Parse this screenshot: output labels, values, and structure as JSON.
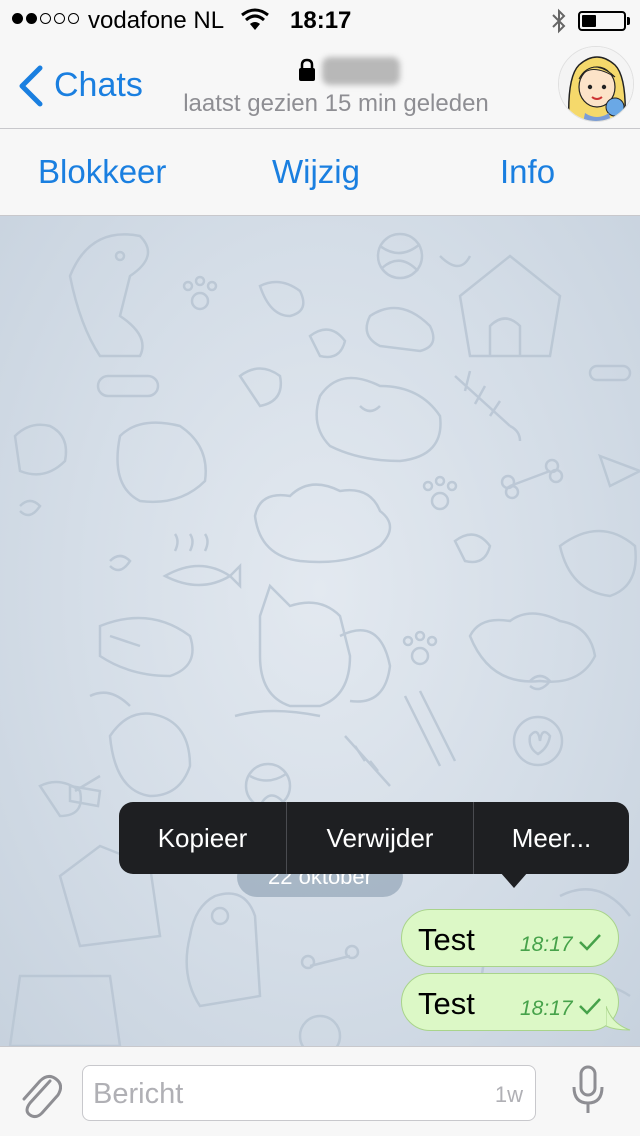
{
  "status_bar": {
    "carrier": "vodafone NL",
    "time": "18:17",
    "signal_bars_filled": 2,
    "signal_bars_total": 5,
    "battery_level": 0.35
  },
  "nav": {
    "back_label": "Chats",
    "last_seen": "laatst gezien 15 min geleden",
    "lock_icon": "lock-icon",
    "avatar_icon": "avatar"
  },
  "actions": {
    "block": "Blokkeer",
    "edit": "Wijzig",
    "info": "Info"
  },
  "chat": {
    "date_pill": "22 oktober",
    "messages": [
      {
        "text": "Test",
        "time": "18:17",
        "status": "sent"
      },
      {
        "text": "Test",
        "time": "18:17",
        "status": "sent"
      }
    ]
  },
  "context_menu": {
    "copy": "Kopieer",
    "delete": "Verwijder",
    "more": "Meer..."
  },
  "input": {
    "placeholder": "Bericht",
    "hint": "1w"
  },
  "colors": {
    "accent": "#1a7fe0",
    "bubble": "#dcf8c6",
    "bubble_time": "#46a24a",
    "menu_bg": "#1e1f22"
  }
}
